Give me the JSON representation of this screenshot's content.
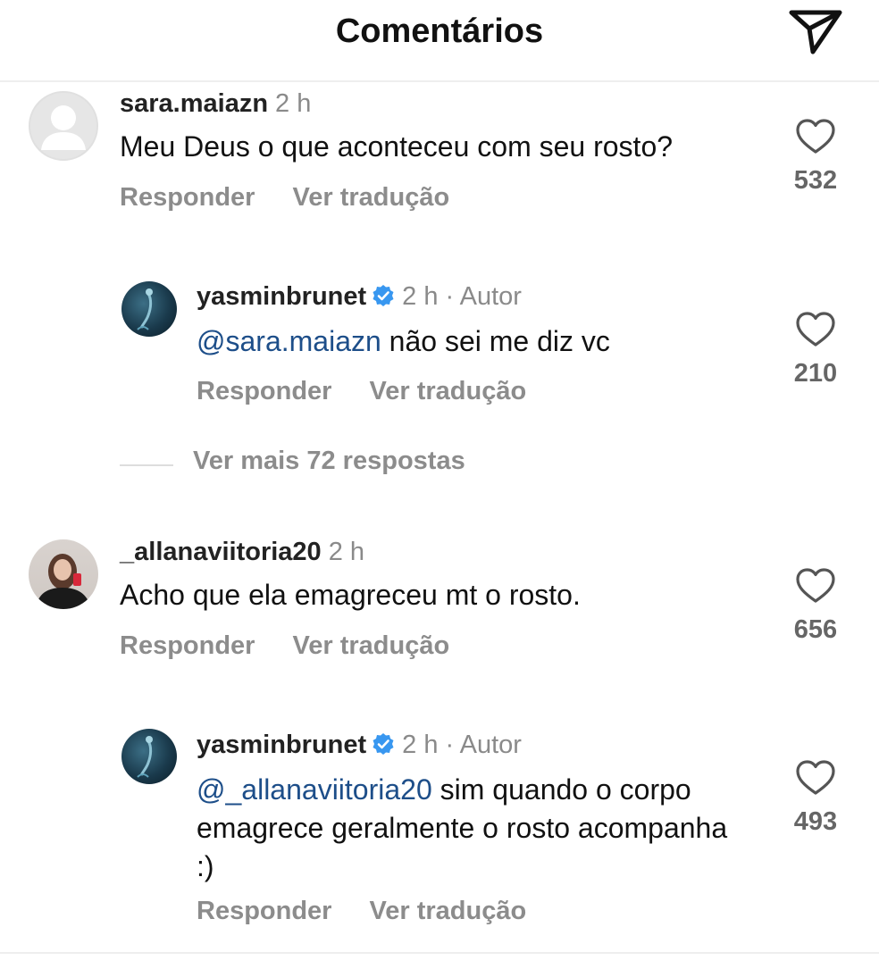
{
  "header": {
    "title": "Comentários",
    "send_icon": "paper-plane-icon"
  },
  "comments": [
    {
      "username": "sara.maiazn",
      "time": "2 h",
      "author_tag": "",
      "verified": false,
      "text": "Meu Deus o que aconteceu com seu rosto?",
      "mention": "",
      "reply_label": "Responder",
      "translate_label": "Ver tradução",
      "likes": "532"
    },
    {
      "username": "yasminbrunet",
      "time": "2 h",
      "author_tag": "· Autor",
      "verified": true,
      "mention": "@sara.maiazn",
      "text": " não sei me diz vc",
      "reply_label": "Responder",
      "translate_label": "Ver tradução",
      "likes": "210"
    },
    {
      "username": "_allanaviitoria20",
      "time": "2 h",
      "author_tag": "",
      "verified": false,
      "text": "Acho que ela emagreceu mt o rosto.",
      "mention": "",
      "reply_label": "Responder",
      "translate_label": "Ver tradução",
      "likes": "656"
    },
    {
      "username": "yasminbrunet",
      "time": "2 h",
      "author_tag": "· Autor",
      "verified": true,
      "mention": "@_allanaviitoria20",
      "text": " sim quando o corpo emagrece geralmente o rosto acompanha :)",
      "reply_label": "Responder",
      "translate_label": "Ver tradução",
      "likes": "493"
    }
  ],
  "more_replies": "Ver mais 72 respostas",
  "colors": {
    "mention": "#1d4e89",
    "verified": "#3897f0",
    "muted": "#8c8c8c"
  }
}
